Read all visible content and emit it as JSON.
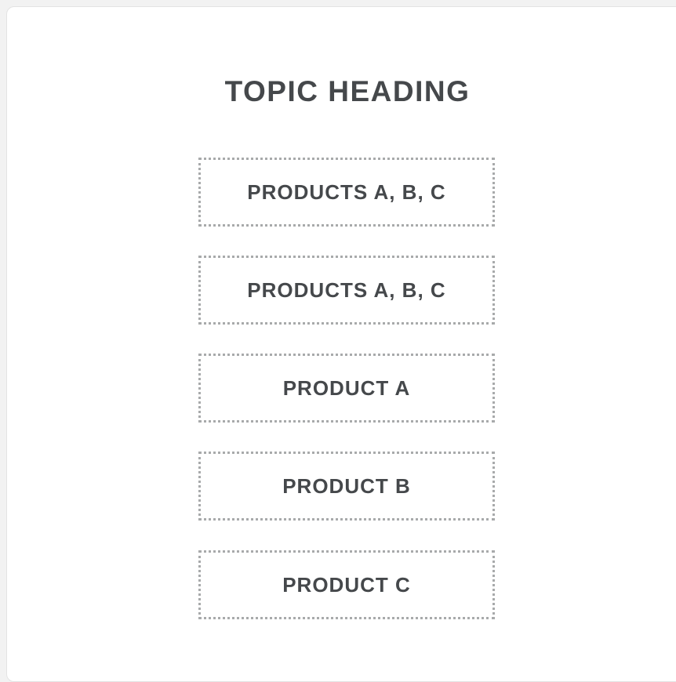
{
  "heading": "TOPIC HEADING",
  "items": [
    {
      "label": "PRODUCTS A, B, C"
    },
    {
      "label": "PRODUCTS A, B, C"
    },
    {
      "label": "PRODUCT A"
    },
    {
      "label": "PRODUCT B"
    },
    {
      "label": "PRODUCT C"
    }
  ],
  "colors": {
    "text": "#45484b",
    "dotted_border": "#a8aaab",
    "panel_background": "#ffffff",
    "page_background": "#f2f2f2"
  }
}
